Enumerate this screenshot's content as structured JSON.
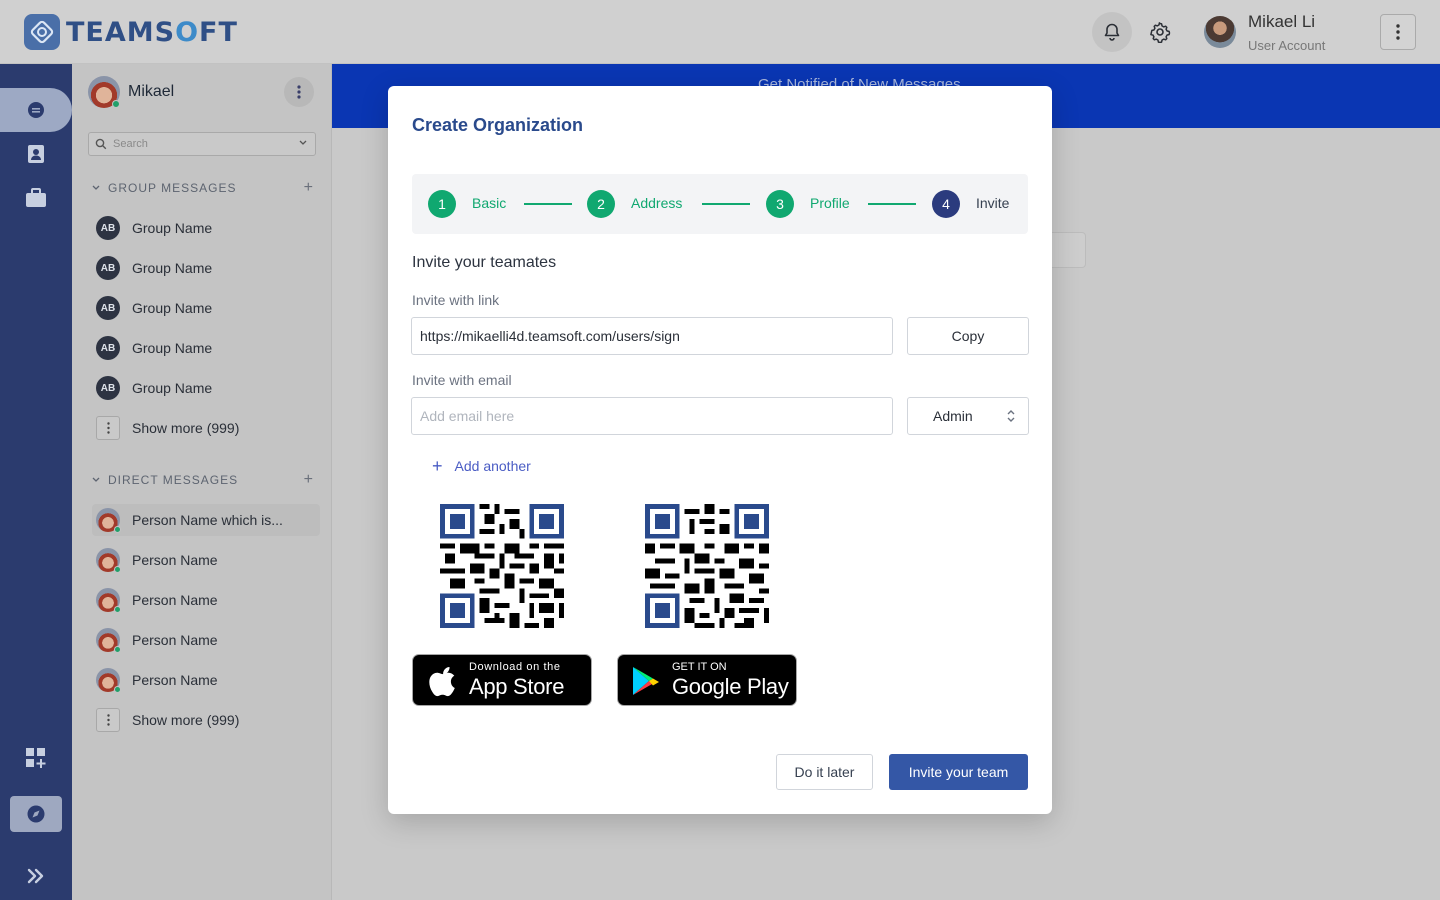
{
  "header": {
    "logo_text_a": "TEAMS",
    "logo_text_o": "O",
    "logo_text_b": "FT",
    "user_name": "Mikael Li",
    "user_role": "User Account"
  },
  "sidebar": {
    "user_name": "Mikael",
    "search_placeholder": "Search",
    "group_section_label": "GROUP MESSAGES",
    "groups": [
      {
        "initials": "AB",
        "label": "Group Name"
      },
      {
        "initials": "AB",
        "label": "Group Name"
      },
      {
        "initials": "AB",
        "label": "Group Name"
      },
      {
        "initials": "AB",
        "label": "Group Name"
      },
      {
        "initials": "AB",
        "label": "Group Name"
      }
    ],
    "groups_more": "Show more (999)",
    "direct_section_label": "DIRECT MESSAGES",
    "directs": [
      {
        "label": "Person Name which is..."
      },
      {
        "label": "Person Name"
      },
      {
        "label": "Person Name"
      },
      {
        "label": "Person Name"
      },
      {
        "label": "Person Name"
      }
    ],
    "directs_more": "Show more (999)"
  },
  "background": {
    "banner_text": "Get Notified of New Messages"
  },
  "modal": {
    "title": "Create Organization",
    "steps": [
      {
        "num": "1",
        "label": "Basic",
        "state": "done"
      },
      {
        "num": "2",
        "label": "Address",
        "state": "done"
      },
      {
        "num": "3",
        "label": "Profile",
        "state": "done"
      },
      {
        "num": "4",
        "label": "Invite",
        "state": "current"
      }
    ],
    "section_title": "Invite your teamates",
    "link_label": "Invite with link",
    "link_value": "https://mikaelli4d.teamsoft.com/users/sign",
    "copy_label": "Copy",
    "email_label": "Invite with email",
    "email_placeholder": "Add email here",
    "role_value": "Admin",
    "add_another": "Add another",
    "app_store": {
      "small": "Download on the",
      "big": "App Store"
    },
    "google_play": {
      "small": "GET IT ON",
      "big": "Google Play"
    },
    "later_label": "Do it later",
    "invite_label": "Invite your team"
  },
  "colors": {
    "brand": "#2f4f86",
    "rail": "#2b3b6e",
    "step_done": "#10a870",
    "step_current": "#2b3b7e",
    "primary_button": "#3457a6",
    "banner": "#0a36b3"
  }
}
